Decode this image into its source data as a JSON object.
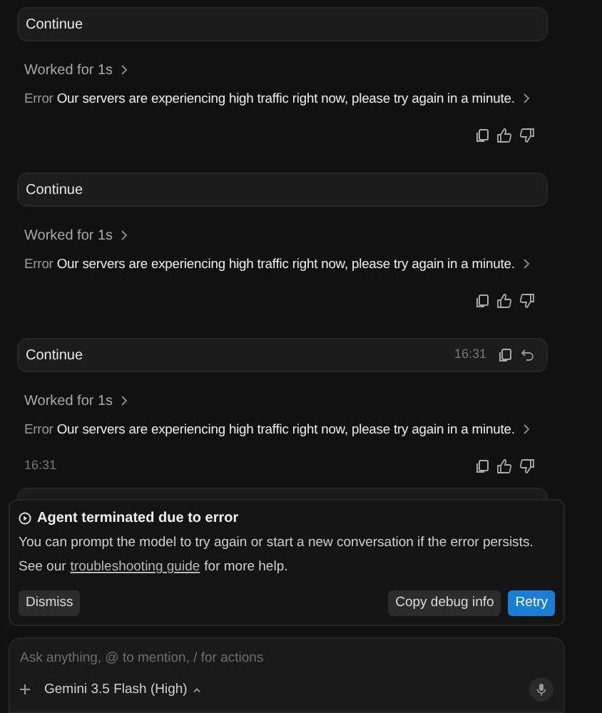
{
  "messages": [
    {
      "prompt": "Continue",
      "worked": "Worked for 1s",
      "error_label": "Error",
      "error_text": "Our servers are experiencing high traffic right now, please try again in a minute."
    },
    {
      "prompt": "Continue",
      "worked": "Worked for 1s",
      "error_label": "Error",
      "error_text": "Our servers are experiencing high traffic right now, please try again in a minute."
    },
    {
      "prompt": "Continue",
      "prompt_time": "16:31",
      "worked": "Worked for 1s",
      "error_label": "Error",
      "error_text": "Our servers are experiencing high traffic right now, please try again in a minute.",
      "footer_time": "16:31"
    }
  ],
  "error_panel": {
    "title": "Agent terminated due to error",
    "body": "You can prompt the model to try again or start a new conversation if the error persists.",
    "help_prefix": "See our",
    "help_link": "troubleshooting guide",
    "help_suffix": "for more help.",
    "buttons": [
      {
        "label": "Dismiss",
        "kind": "secondary"
      },
      {
        "label": "Copy debug info",
        "kind": "secondary"
      },
      {
        "label": "Retry",
        "kind": "primary"
      }
    ]
  },
  "composer": {
    "placeholder": "Ask anything, @ to mention, / for actions",
    "model": "Gemini 3.5 Flash (High)"
  }
}
